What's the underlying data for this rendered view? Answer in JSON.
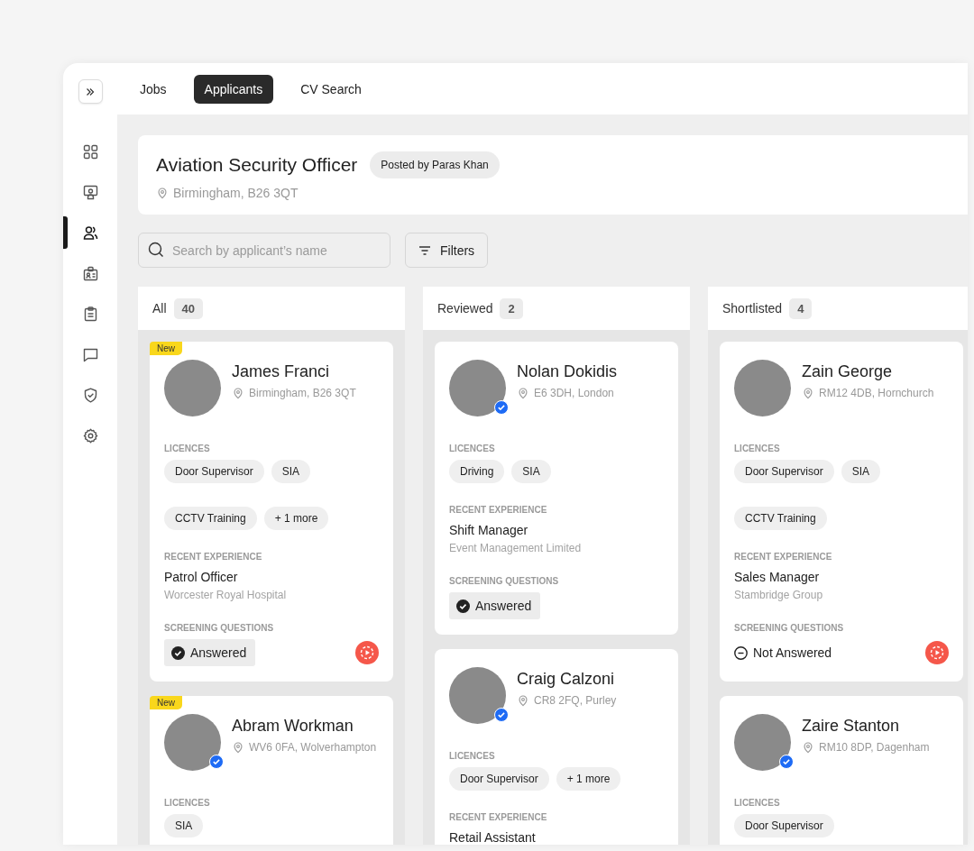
{
  "nav": [
    {
      "selected": false
    },
    {
      "selected": false
    },
    {
      "selected": true
    },
    {
      "selected": false
    },
    {
      "selected": false
    },
    {
      "selected": false
    },
    {
      "selected": false
    },
    {
      "selected": false
    }
  ],
  "tabs": [
    {
      "label": "Jobs",
      "selected": false
    },
    {
      "label": "Applicants",
      "selected": true
    },
    {
      "label": "CV Search",
      "selected": false
    }
  ],
  "job": {
    "title": "Aviation Security Officer",
    "posted_by": "Posted by Paras Khan",
    "location": "Birmingham, B26 3QT"
  },
  "search": {
    "placeholder": "Search by applicant’s name"
  },
  "filters": {
    "label": "Filters"
  },
  "columns": [
    {
      "title": "All",
      "count": "40",
      "applicants": [
        {
          "badge": "New",
          "name": "James Franci",
          "verified": false,
          "location": "Birmingham, B26 3QT",
          "sections": [
            {
              "kind": "chips",
              "label": "LICENCES",
              "chips": [
                "Door Supervisor",
                "SIA",
                "CCTV Training",
                "+ 1 more"
              ]
            },
            {
              "kind": "experience",
              "label": "RECENT EXPERIENCE",
              "role": "Patrol Officer",
              "company": "Worcester Royal Hospital"
            },
            {
              "kind": "screening",
              "label": "SCREENING QUESTIONS",
              "answer": {
                "kind": "answered",
                "text": "Answered"
              },
              "video": true
            }
          ]
        },
        {
          "badge": "New",
          "name": "Abram Workman",
          "verified": true,
          "location": "WV6 0FA, Wolverhampton",
          "sections": [
            {
              "kind": "chips",
              "label": "LICENCES",
              "chips": [
                "SIA"
              ]
            }
          ]
        }
      ]
    },
    {
      "title": "Reviewed",
      "count": "2",
      "applicants": [
        {
          "name": "Nolan Dokidis",
          "verified": true,
          "location": "E6 3DH, London",
          "sections": [
            {
              "kind": "chips",
              "label": "LICENCES",
              "chips": [
                "Driving",
                "SIA"
              ]
            },
            {
              "kind": "experience",
              "label": "RECENT EXPERIENCE",
              "role": "Shift Manager",
              "company": "Event Management Limited"
            },
            {
              "kind": "screening",
              "label": "SCREENING QUESTIONS",
              "answer": {
                "kind": "answered",
                "text": "Answered"
              },
              "video": false
            }
          ]
        },
        {
          "name": "Craig Calzoni",
          "verified": true,
          "location": "CR8 2FQ, Purley",
          "sections": [
            {
              "kind": "chips",
              "label": "LICENCES",
              "chips": [
                "Door Supervisor",
                "+ 1 more"
              ]
            },
            {
              "kind": "experience",
              "label": "RECENT EXPERIENCE",
              "role": "Retail Assistant"
            }
          ]
        }
      ]
    },
    {
      "title": "Shortlisted",
      "count": "4",
      "applicants": [
        {
          "name": "Zain George",
          "verified": false,
          "location": "RM12 4DB, Hornchurch",
          "sections": [
            {
              "kind": "chips",
              "label": "LICENCES",
              "chips": [
                "Door Supervisor",
                "SIA",
                "CCTV Training"
              ]
            },
            {
              "kind": "experience",
              "label": "RECENT EXPERIENCE",
              "role": "Sales Manager",
              "company": "Stambridge Group"
            },
            {
              "kind": "screening",
              "label": "SCREENING QUESTIONS",
              "answer": {
                "kind": "not_answered",
                "text": "Not Answered"
              },
              "video": true
            }
          ]
        },
        {
          "name": "Zaire Stanton",
          "verified": true,
          "location": "RM10 8DP, Dagenham",
          "sections": [
            {
              "kind": "chips",
              "label": "LICENCES",
              "chips": [
                "Door Supervisor"
              ]
            }
          ]
        }
      ]
    }
  ]
}
